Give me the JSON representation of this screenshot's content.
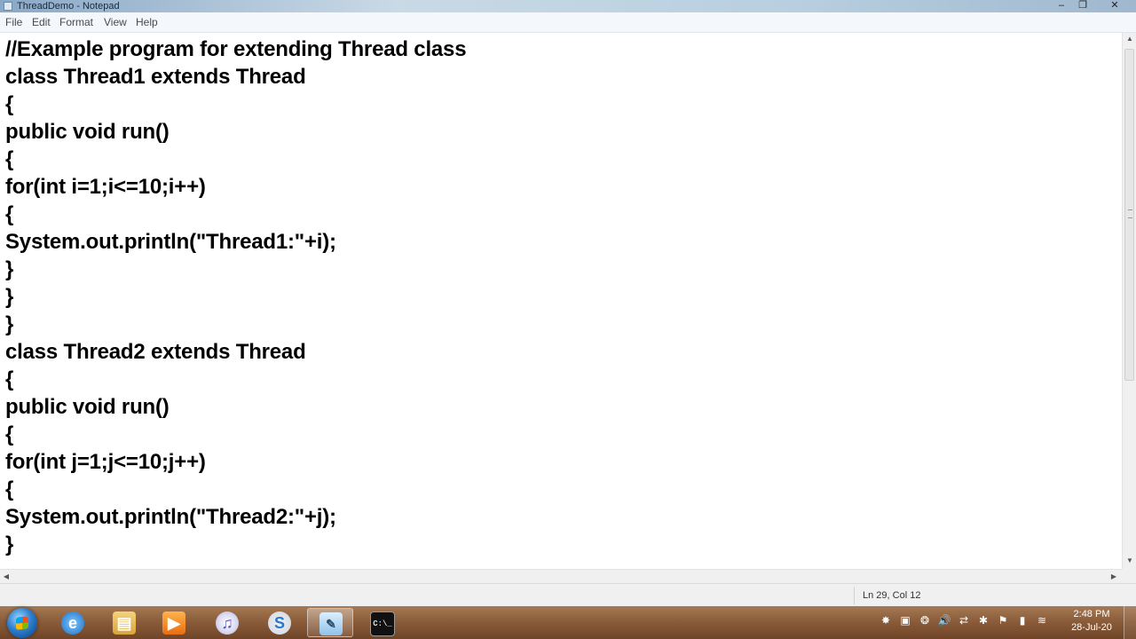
{
  "window": {
    "title": "ThreadDemo - Notepad",
    "minimize": "–",
    "maximize": "❐",
    "close": "✕"
  },
  "menu": {
    "items": [
      "File",
      "Edit",
      "Format",
      "View",
      "Help"
    ]
  },
  "editor": {
    "lines": [
      "//Example program for extending Thread class",
      "class Thread1 extends Thread",
      "{",
      "public void run()",
      "{",
      "for(int i=1;i<=10;i++)",
      "{",
      "System.out.println(\"Thread1:\"+i);",
      "}",
      "}",
      "}",
      "class Thread2 extends Thread",
      "{",
      "public void run()",
      "{",
      "for(int j=1;j<=10;j++)",
      "{",
      "System.out.println(\"Thread2:\"+j);",
      "}"
    ]
  },
  "status": {
    "position": "Ln 29, Col 12"
  },
  "taskbar": {
    "apps": [
      {
        "name": "internet-explorer",
        "glyph": "e",
        "icon": "ic-ie",
        "active": false
      },
      {
        "name": "windows-explorer",
        "glyph": "▤",
        "icon": "ic-explorer",
        "active": false
      },
      {
        "name": "media-player",
        "glyph": "▶",
        "icon": "ic-media",
        "active": false
      },
      {
        "name": "itunes",
        "glyph": "♫",
        "icon": "ic-itunes",
        "active": false
      },
      {
        "name": "skype",
        "glyph": "S",
        "icon": "ic-skype",
        "active": false
      },
      {
        "name": "notepad",
        "glyph": "✎",
        "icon": "ic-notepad",
        "active": true
      },
      {
        "name": "command-prompt",
        "glyph": "C:\\_",
        "icon": "ic-cmd",
        "active": false
      }
    ],
    "tray": [
      {
        "name": "avast-icon",
        "glyph": "✸"
      },
      {
        "name": "action-center-icon",
        "glyph": "▣"
      },
      {
        "name": "update-icon",
        "glyph": "❂"
      },
      {
        "name": "volume-icon",
        "glyph": "🔊"
      },
      {
        "name": "usb-icon",
        "glyph": "⇄"
      },
      {
        "name": "bluetooth-icon",
        "glyph": "✱"
      },
      {
        "name": "flag-icon",
        "glyph": "⚑"
      },
      {
        "name": "network-icon",
        "glyph": "▮"
      },
      {
        "name": "wifi-icon",
        "glyph": "≋"
      },
      {
        "name": "cloud-icon",
        "glyph": "☁"
      }
    ],
    "clock_time": "2:48 PM",
    "clock_date": "28-Jul-20"
  }
}
